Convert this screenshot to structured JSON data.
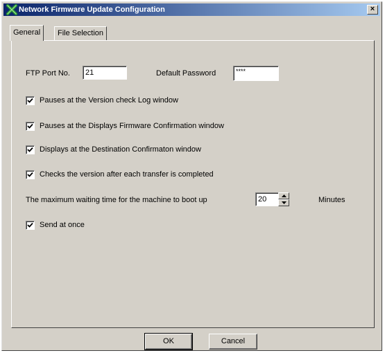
{
  "window": {
    "title": "Network Firmware Update Configuration",
    "close_label": "×"
  },
  "tabs": [
    {
      "label": "General"
    },
    {
      "label": "File Selection"
    }
  ],
  "ftp_port": {
    "label": "FTP Port No.",
    "value": "21"
  },
  "default_password": {
    "label": "Default Password",
    "value": "****"
  },
  "options": [
    {
      "label": "Pauses at the Version check Log window",
      "checked": true
    },
    {
      "label": "Pauses at the Displays Firmware Confirmation window",
      "checked": true
    },
    {
      "label": "Displays at the Destination Confirmaton window",
      "checked": true
    },
    {
      "label": "Checks the version after each transfer is completed",
      "checked": true
    }
  ],
  "boot_wait": {
    "label": "The maximum waiting time for the machine to boot up",
    "value": "20",
    "unit": "Minutes"
  },
  "send_at_once": {
    "label": "Send at once",
    "checked": true
  },
  "buttons": {
    "ok": "OK",
    "cancel": "Cancel"
  },
  "colors": {
    "face": "#d4d0c8",
    "title_start": "#0a246a",
    "title_end": "#a6caf0",
    "icon": "#2e9a2e"
  }
}
